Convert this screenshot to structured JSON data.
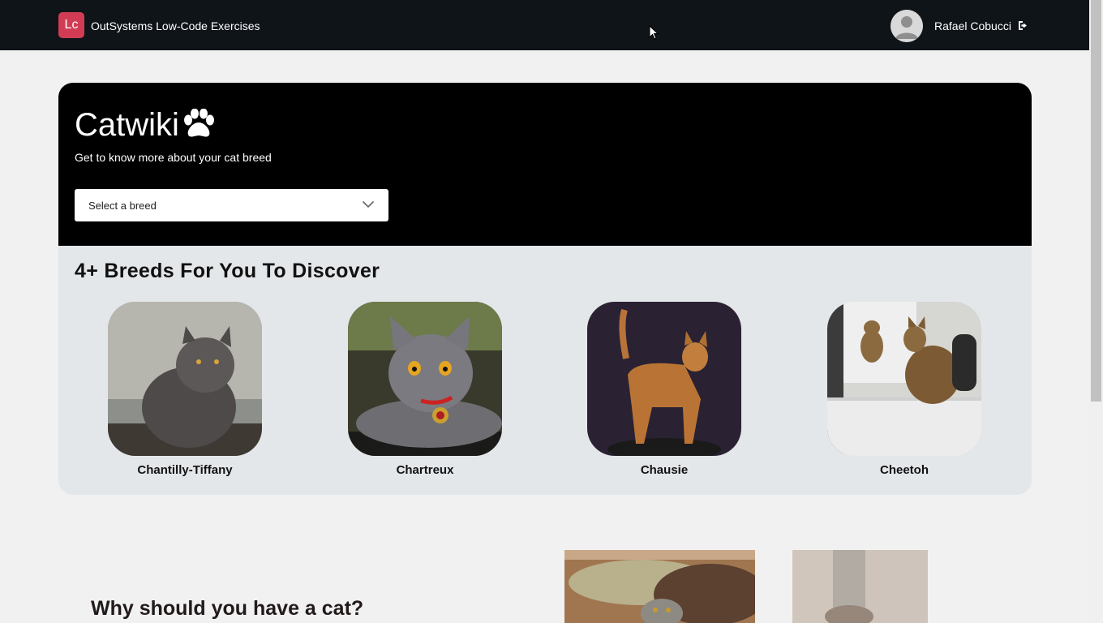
{
  "header": {
    "logo_text": "Lc",
    "app_title": "OutSystems Low-Code Exercises",
    "user_name": "Rafael Cobucci"
  },
  "hero": {
    "title": "Catwiki",
    "subtitle": "Get to know more about your cat breed",
    "select_placeholder": "Select a breed"
  },
  "breeds": {
    "heading": "4+ Breeds For You To Discover",
    "items": [
      {
        "name": "Chantilly-Tiffany"
      },
      {
        "name": "Chartreux"
      },
      {
        "name": "Chausie"
      },
      {
        "name": "Cheetoh"
      }
    ]
  },
  "why": {
    "heading": "Why should you have a cat?"
  },
  "colors": {
    "logo_bg": "#d13c54",
    "topbar_bg": "#0f1419",
    "hero_dark": "#000000",
    "hero_light": "#e4e7ea"
  }
}
